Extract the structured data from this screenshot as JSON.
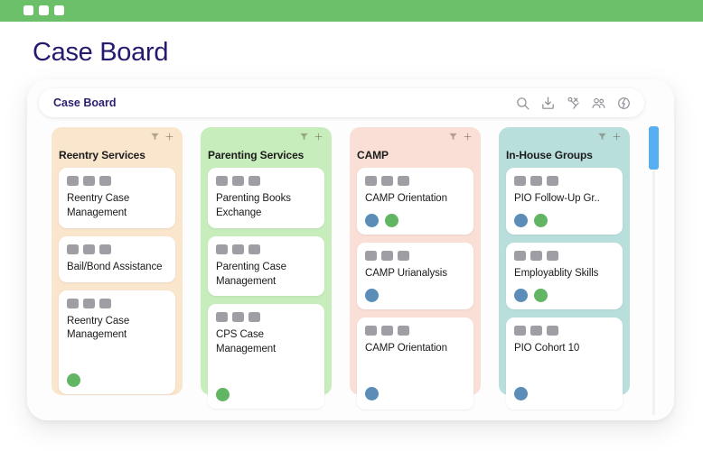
{
  "window": {
    "chrome_color": "#6cc069",
    "dots": [
      "window-dot-1",
      "window-dot-2",
      "window-dot-3"
    ]
  },
  "page": {
    "title": "Case Board",
    "title_color": "#241a6e"
  },
  "search": {
    "board_name": "Case Board",
    "icons": [
      {
        "name": "search-icon",
        "label": "Search"
      },
      {
        "name": "import-icon",
        "label": "Import"
      },
      {
        "name": "automation-icon",
        "label": "Automations"
      },
      {
        "name": "people-icon",
        "label": "Members"
      },
      {
        "name": "integration-icon",
        "label": "Integrations"
      }
    ]
  },
  "scrollbar": {
    "thumb_color": "#57aef0",
    "track_color": "#f1f1f3"
  },
  "board": {
    "column_icons": [
      {
        "name": "filter-icon",
        "label": "Filter"
      },
      {
        "name": "add-card-icon",
        "label": "Add card"
      }
    ],
    "columns": [
      {
        "title": "Reentry Services",
        "bg": "#fae5cd",
        "cards": [
          {
            "title": "Reentry Case Management",
            "tags": 3,
            "avatars": []
          },
          {
            "title": "Bail/Bond Assistance",
            "tags": 3,
            "avatars": []
          },
          {
            "title": "Reentry Case Management",
            "tags": 3,
            "avatars": [
              "#62b563"
            ],
            "spaced": true
          }
        ]
      },
      {
        "title": "Parenting Services",
        "bg": "#c7edbd",
        "cards": [
          {
            "title": "Parenting Books Exchange",
            "tags": 3,
            "avatars": []
          },
          {
            "title": "Parenting Case Management",
            "tags": 3,
            "avatars": []
          },
          {
            "title": "CPS Case Management",
            "tags": 3,
            "avatars": [
              "#62b563"
            ],
            "spaced": true
          }
        ]
      },
      {
        "title": "CAMP",
        "bg": "#fadfd6",
        "cards": [
          {
            "title": "CAMP Orientation",
            "tags": 3,
            "avatars": [
              "#5b8db8",
              "#62b563"
            ]
          },
          {
            "title": "CAMP Urianalysis",
            "tags": 3,
            "avatars": [
              "#5b8db8"
            ]
          },
          {
            "title": "CAMP Orientation",
            "tags": 3,
            "avatars": [
              "#5b8db8"
            ],
            "spaced": true
          }
        ]
      },
      {
        "title": "In-House Groups",
        "bg": "#b9dfdc",
        "cards": [
          {
            "title": "PIO Follow-Up Gr..",
            "tags": 3,
            "avatars": [
              "#5b8db8",
              "#62b563"
            ]
          },
          {
            "title": "Employablity Skills",
            "tags": 3,
            "avatars": [
              "#5b8db8",
              "#62b563"
            ]
          },
          {
            "title": "PIO Cohort 10",
            "tags": 3,
            "avatars": [
              "#5b8db8"
            ],
            "spaced": true
          }
        ]
      }
    ]
  }
}
